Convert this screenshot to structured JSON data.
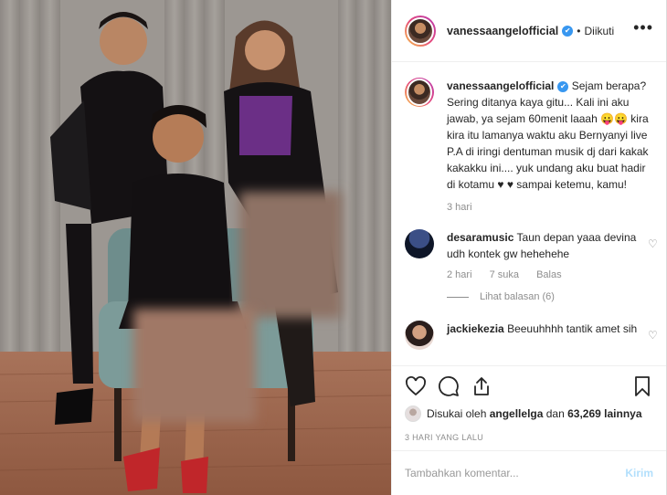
{
  "post": {
    "username": "vanessaangelofficial",
    "separator": "•",
    "follow_status": "Diikuti",
    "more_label": "•••"
  },
  "caption": {
    "username": "vanessaangelofficial",
    "text": "Sejam berapa? Sering ditanya kaya gitu... Kali ini aku jawab, ya sejam 60menit laaah 😛😛 kira kira itu lamanya waktu aku Bernyanyi live P.A di iringi dentuman musik dj dari kakak kakakku ini.... yuk undang aku buat hadir di kotamu ♥ ♥ sampai ketemu, kamu!",
    "age": "3 hari"
  },
  "comments": [
    {
      "username": "desaramusic",
      "text": "Taun depan yaaa devina udh kontek gw hehehehe",
      "age": "2 hari",
      "likes": "7 suka",
      "reply_label": "Balas",
      "view_replies": "Lihat balasan (6)"
    },
    {
      "username": "jackiekezia",
      "text": "Beeuuhhhh tantik amet sih"
    }
  ],
  "likes": {
    "prefix": "Disukai oleh",
    "user": "angellelga",
    "conjunction": "dan",
    "count": "63,269 lainnya"
  },
  "timestamp": "3 HARI YANG LALU",
  "add_comment": {
    "placeholder": "Tambahkan komentar...",
    "send_label": "Kirim"
  },
  "colors": {
    "verified": "#3897f0",
    "send_disabled": "#b2dffc",
    "meta_gray": "#8e8e8e"
  },
  "icons": [
    "heart-icon",
    "comment-icon",
    "share-icon",
    "bookmark-icon",
    "verified-icon",
    "more-icon"
  ]
}
